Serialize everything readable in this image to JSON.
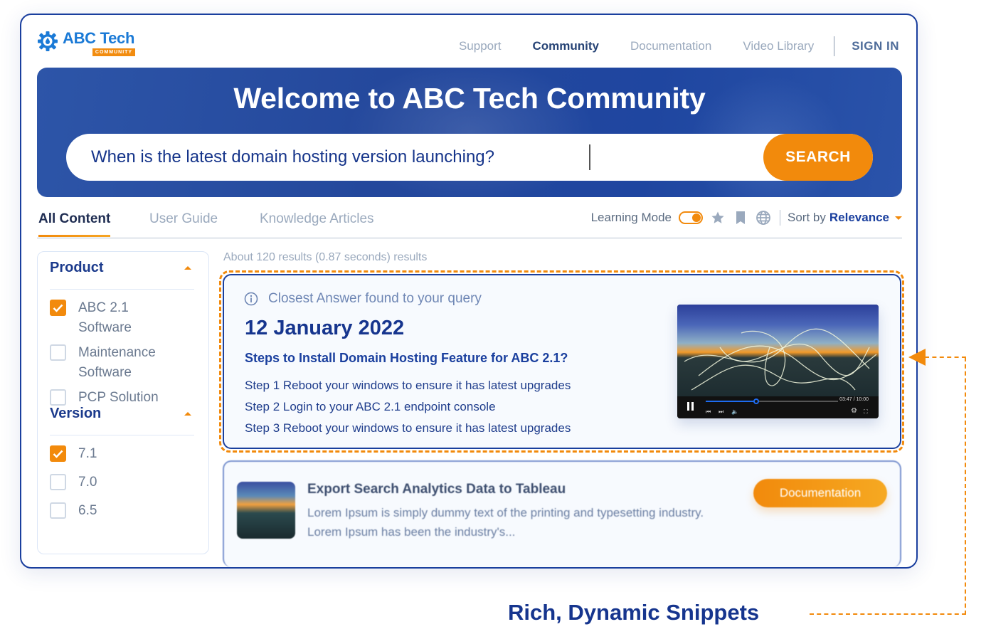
{
  "header": {
    "logo_name": "ABC Tech",
    "logo_badge": "COMMUNITY",
    "nav": [
      {
        "label": "Support",
        "active": false
      },
      {
        "label": "Community",
        "active": true
      },
      {
        "label": "Documentation",
        "active": false
      },
      {
        "label": "Video Library",
        "active": false
      }
    ],
    "sign_in": "SIGN IN"
  },
  "hero": {
    "title": "Welcome to ABC Tech Community",
    "search_value": "When is the latest domain hosting version launching?",
    "search_button": "SEARCH"
  },
  "tabs": [
    {
      "label": "All Content",
      "active": true
    },
    {
      "label": "User Guide",
      "active": false
    },
    {
      "label": "Knowledge Articles",
      "active": false
    }
  ],
  "tools": {
    "learning_mode_label": "Learning Mode",
    "learning_mode_on": true,
    "icons": [
      "star-icon",
      "bookmark-icon",
      "globe-icon"
    ],
    "sort_label": "Sort by",
    "sort_value": "Relevance"
  },
  "sidebar": {
    "facets": [
      {
        "title": "Product",
        "options": [
          {
            "label": "ABC 2.1 Software",
            "checked": true
          },
          {
            "label": "Maintenance Software",
            "checked": false
          },
          {
            "label": "PCP Solution",
            "checked": false
          }
        ]
      },
      {
        "title": "Version",
        "options": [
          {
            "label": "7.1",
            "checked": true
          },
          {
            "label": "7.0",
            "checked": false
          },
          {
            "label": "6.5",
            "checked": false
          }
        ]
      }
    ]
  },
  "results": {
    "meta": "About 120 results (0.87 seconds) results",
    "answer": {
      "hint": "Closest Answer found to your query",
      "date": "12 January 2022",
      "question": "Steps to Install Domain Hosting Feature for ABC 2.1?",
      "steps": [
        "Step 1 Reboot your windows to ensure it has latest upgrades",
        "Step 2 Login to your ABC 2.1 endpoint console",
        "Step 3 Reboot your windows to ensure it has latest upgrades"
      ],
      "video": {
        "time": "03:47 / 10:00",
        "progress": 0.38
      }
    },
    "items": [
      {
        "title": "Export Search Analytics Data to Tableau",
        "description": "Lorem Ipsum is simply dummy text of the printing and typesetting industry. Lorem Ipsum has been the industry's...",
        "badge": "Documentation"
      }
    ]
  },
  "annotation": {
    "label": "Rich, Dynamic Snippets"
  },
  "colors": {
    "brand_blue": "#1a3f9e",
    "accent_orange": "#f28a0c",
    "logo_blue": "#1b7ad6"
  }
}
